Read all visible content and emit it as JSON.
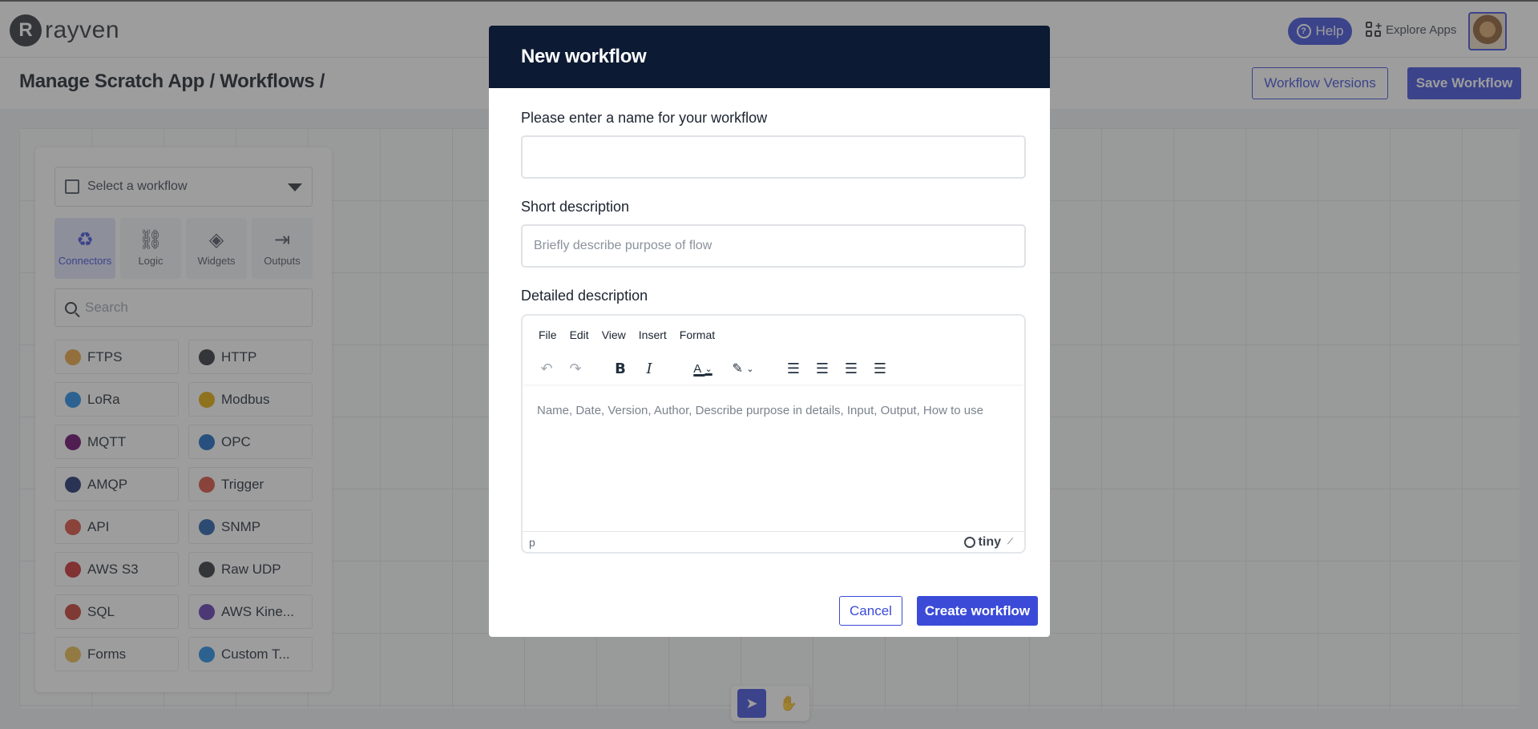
{
  "app": {
    "logo_mark": "R",
    "logo_text": "rayven"
  },
  "topbar": {
    "help_label": "Help",
    "explore_label": "Explore Apps"
  },
  "header": {
    "breadcrumb": "Manage Scratch App / Workflows  /",
    "versions_label": "Workflow Versions",
    "save_label": "Save Workflow"
  },
  "panel": {
    "select_placeholder": "Select a workflow",
    "tabs": [
      {
        "label": "Connectors",
        "icon": "recycle-icon",
        "active": true
      },
      {
        "label": "Logic",
        "icon": "link-icon",
        "active": false
      },
      {
        "label": "Widgets",
        "icon": "layers-icon",
        "active": false
      },
      {
        "label": "Outputs",
        "icon": "logout-icon",
        "active": false
      }
    ],
    "search_placeholder": "Search",
    "connectors": [
      {
        "label": "FTPS",
        "color": "#e8a33d"
      },
      {
        "label": "HTTP",
        "color": "#2b2f36"
      },
      {
        "label": "LoRa",
        "color": "#1e88e5"
      },
      {
        "label": "Modbus",
        "color": "#e0a800"
      },
      {
        "label": "MQTT",
        "color": "#660066"
      },
      {
        "label": "OPC",
        "color": "#1565c0"
      },
      {
        "label": "AMQP",
        "color": "#1a2a6c"
      },
      {
        "label": "Trigger",
        "color": "#d84a3a"
      },
      {
        "label": "API",
        "color": "#d84a3a"
      },
      {
        "label": "SNMP",
        "color": "#1e5aa8"
      },
      {
        "label": "AWS S3",
        "color": "#c62828"
      },
      {
        "label": "Raw UDP",
        "color": "#2b2f36"
      },
      {
        "label": "SQL",
        "color": "#c0392b"
      },
      {
        "label": "AWS Kine...",
        "color": "#5e35b1"
      },
      {
        "label": "Forms",
        "color": "#e8b84a"
      },
      {
        "label": "Custom T...",
        "color": "#1e88e5"
      }
    ]
  },
  "modal": {
    "title": "New workflow",
    "name_label": "Please enter a name for your workflow",
    "name_value": "",
    "short_label": "Short description",
    "short_placeholder": "Briefly describe purpose of flow",
    "detailed_label": "Detailed description",
    "editor": {
      "menu": [
        "File",
        "Edit",
        "View",
        "Insert",
        "Format"
      ],
      "placeholder": "Name, Date, Version, Author, Describe purpose in details, Input, Output, How to use",
      "status_path": "p",
      "brand": "tiny"
    },
    "cancel_label": "Cancel",
    "create_label": "Create workflow"
  },
  "colors": {
    "primary": "#3b4bd8",
    "modal_header": "#0c1a33"
  }
}
